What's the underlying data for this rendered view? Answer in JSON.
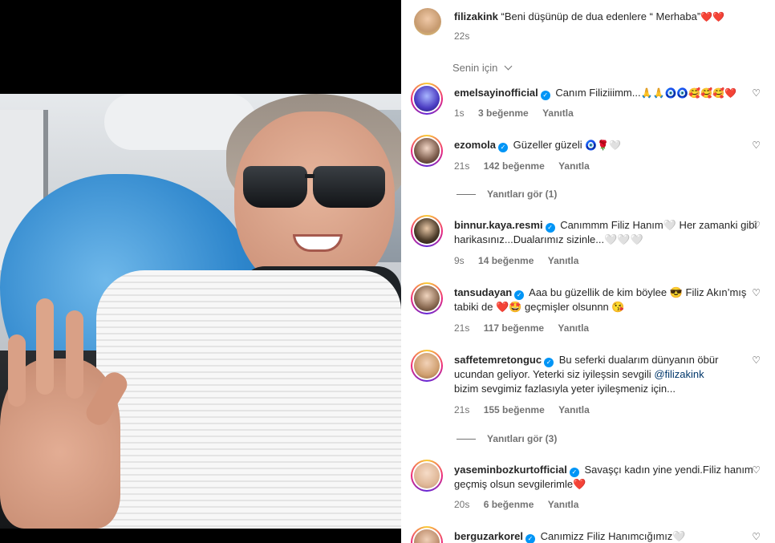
{
  "post": {
    "author": "filizakink",
    "caption": "“Beni düşünüp de dua edenlere “ Merhaba”",
    "caption_emoji": "❤️❤️",
    "time": "22s"
  },
  "sort": {
    "label": "Senin için"
  },
  "comments": [
    {
      "user": "emelsayinofficial",
      "text": "Canım Filiziiimm...",
      "emoji": "🙏🙏🧿🧿🥰🥰🥰❤️",
      "time": "1s",
      "likes": "3 beğenme",
      "reply": "Yanıtla"
    },
    {
      "user": "ezomola",
      "text": "Güzeller güzeli",
      "emoji": "🧿🌹🤍",
      "time": "21s",
      "likes": "142 beğenme",
      "reply": "Yanıtla",
      "view_replies": "Yanıtları gör (1)"
    },
    {
      "user": "binnur.kaya.resmi",
      "text_line1": "Canımmm Filiz Hanım🤍 Her zamanki gibi",
      "text_line2": "harikasınız...Dualarımız sizinle...🤍🤍🤍",
      "time": "9s",
      "likes": "14 beğenme",
      "reply": "Yanıtla"
    },
    {
      "user": "tansudayan",
      "text_line1": "Aaa bu güzellik de kim böylee 😎  Filiz Akın’mış",
      "text_line2": "tabiki de ❤️🤩 geçmişler olsunnn 😘",
      "time": "21s",
      "likes": "117 beğenme",
      "reply": "Yanıtla"
    },
    {
      "user": "saffetemretonguc",
      "text_line1": "Bu seferki dualarım dünyanın öbür",
      "text_line2_a": "ucundan geliyor. Yeterki siz iyileşsin sevgili ",
      "mention": "@filizakink",
      "text_line3": "bizim sevgimiz fazlasıyla yeter iyileşmeniz için...",
      "time": "21s",
      "likes": "155 beğenme",
      "reply": "Yanıtla",
      "view_replies": "Yanıtları gör (3)"
    },
    {
      "user": "yaseminbozkurtofficial",
      "text_line1": "Savaşçı kadın yine yendi.Filiz hanım",
      "text_line2": "geçmiş olsun sevgilerimle❤️",
      "time": "20s",
      "likes": "6 beğenme",
      "reply": "Yanıtla"
    },
    {
      "user": "berguzarkorel",
      "text": "Canımizz Filiz Hanımcığımız🤍"
    }
  ],
  "icons": {
    "like": "heart-outline-icon",
    "verified": "verified-badge-icon",
    "sort": "chevron-down-icon"
  },
  "colors": {
    "verified": "#0095f6",
    "muted": "#737373",
    "mention": "#00376b",
    "heart": "#ed1c24"
  }
}
